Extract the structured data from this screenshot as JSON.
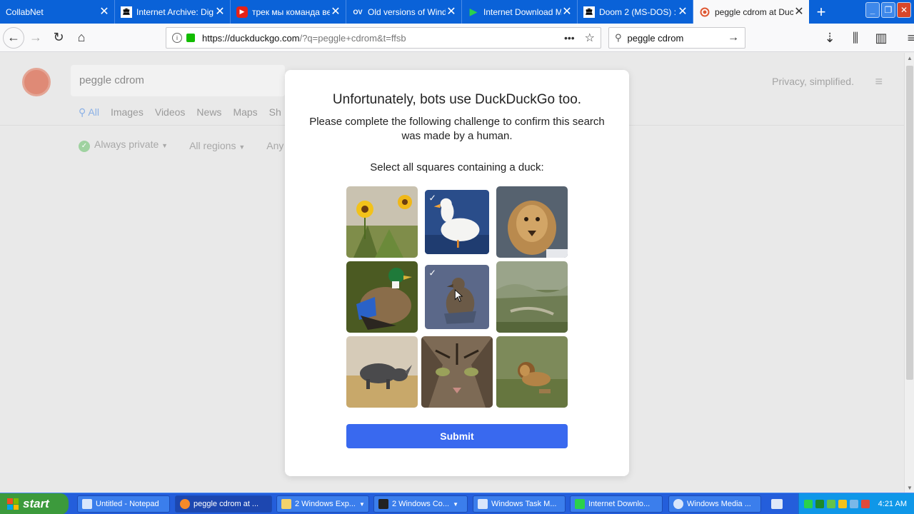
{
  "browser": {
    "tabs": [
      {
        "label": "CollabNet",
        "icon": "collabnet-favicon",
        "active": false
      },
      {
        "label": "Internet Archive: Dig",
        "icon": "archive-favicon",
        "active": false
      },
      {
        "label": "трек мы команда ве",
        "icon": "youtube-favicon",
        "active": false
      },
      {
        "label": "Old versions of Wind",
        "icon": "oldversion-favicon",
        "active": false
      },
      {
        "label": "Internet Download M",
        "icon": "idm-favicon",
        "active": false
      },
      {
        "label": "Doom 2 (MS-DOS) : I",
        "icon": "archive-favicon",
        "active": false
      },
      {
        "label": "peggle cdrom at Duc",
        "icon": "duckduckgo-favicon",
        "active": true
      }
    ],
    "url_host": "https://duckduckgo.com",
    "url_rest": "/?q=peggle+cdrom&t=ffsb",
    "search_value": "peggle cdrom"
  },
  "ddg": {
    "search_value": "peggle cdrom",
    "nav": [
      "All",
      "Images",
      "Videos",
      "News",
      "Maps",
      "Sh"
    ],
    "filters": [
      "Always private",
      "All regions",
      "Any"
    ],
    "privacy": "Privacy, simplified."
  },
  "challenge": {
    "title": "Unfortunately, bots use DuckDuckGo too.",
    "subtitle": "Please complete the following challenge to confirm this search was made by a human.",
    "instruction": "Select all squares containing a duck:",
    "tiles": [
      {
        "subject": "sunflowers",
        "selected": false
      },
      {
        "subject": "white duck",
        "selected": true
      },
      {
        "subject": "lioness",
        "selected": false
      },
      {
        "subject": "mallard duck",
        "selected": false
      },
      {
        "subject": "duckling",
        "selected": true
      },
      {
        "subject": "grassland",
        "selected": false
      },
      {
        "subject": "rhinoceros",
        "selected": false
      },
      {
        "subject": "cat",
        "selected": false
      },
      {
        "subject": "lion",
        "selected": false
      }
    ],
    "submit": "Submit"
  },
  "taskbar": {
    "start": "start",
    "buttons": [
      "Untitled - Notepad",
      "peggle cdrom at ...",
      "2 Windows Exp...",
      "2 Windows Co...",
      "Windows Task M...",
      "Internet Downlo...",
      "Windows Media ..."
    ],
    "clock": "4:21 AM"
  }
}
